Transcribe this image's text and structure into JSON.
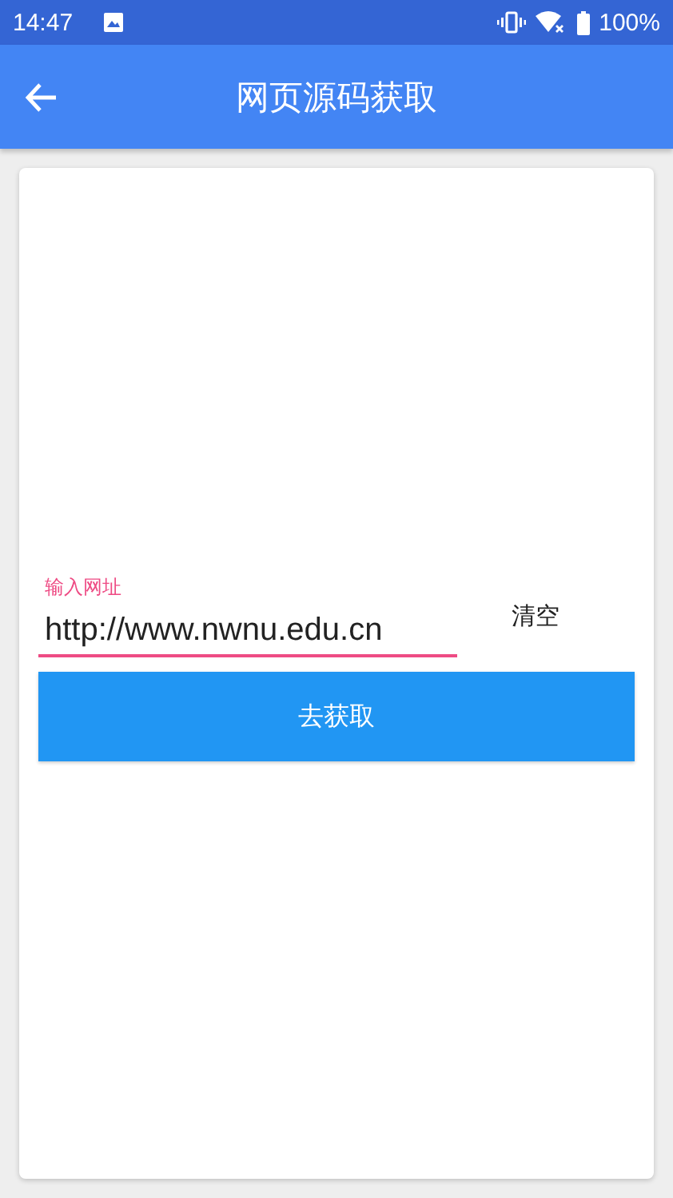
{
  "status_bar": {
    "time": "14:47",
    "battery": "100%"
  },
  "app_bar": {
    "title": "网页源码获取"
  },
  "form": {
    "url_field": {
      "label": "输入网址",
      "value": "http://www.nwnu.edu.cn",
      "focused": true
    },
    "clear_button": "清空",
    "fetch_button": "去获取"
  }
}
